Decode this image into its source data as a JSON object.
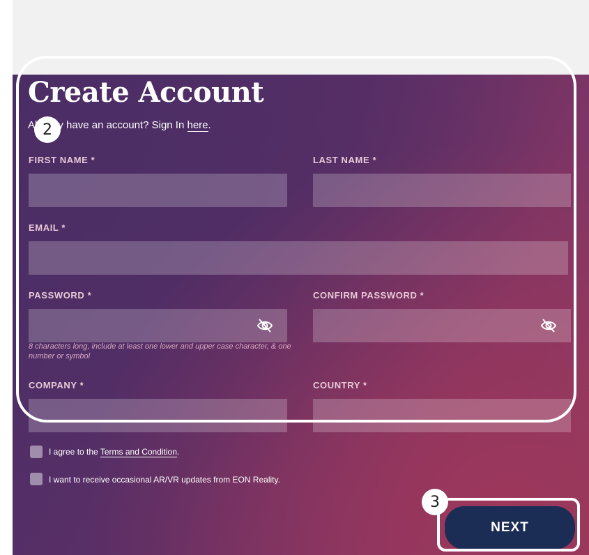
{
  "form": {
    "title": "Create Account",
    "signin_prefix": "Already have an account? Sign In",
    "signin_link": "here",
    "signin_suffix": ".",
    "first_name_label": "FIRST NAME *",
    "last_name_label": "LAST NAME *",
    "email_label": "EMAIL *",
    "password_label": "PASSWORD *",
    "confirm_password_label": "CONFIRM PASSWORD *",
    "password_hint": "8 characters long, include at least one lower and upper case character, & one number or symbol",
    "company_label": "COMPANY *",
    "country_label": "COUNTRY *",
    "terms_prefix": "I agree to the",
    "terms_link": "Terms and Condition",
    "terms_suffix": ".",
    "updates_text": "I want to receive occasional AR/VR updates from EON Reality.",
    "next_label": "NEXT"
  },
  "annotations": {
    "badge_form": "2",
    "badge_next": "3"
  },
  "colors": {
    "panel_start": "#4b2e68",
    "panel_end": "#8c3a62",
    "next_button": "#1c2d55",
    "label": "#e8c9d6"
  },
  "icons": {
    "password_toggle": "eye-slash-icon"
  }
}
